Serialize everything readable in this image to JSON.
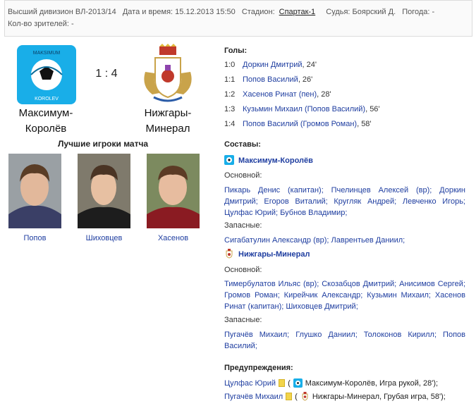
{
  "header": {
    "division": "Высший дивизион ВЛ-2013/14",
    "datetime": "Дата и время: 15.12.2013 15:50",
    "stadium_label": "Стадион:",
    "stadium": "Спартак-1",
    "referee": "Судья: Боярский Д.",
    "weather": "Погода: -",
    "spectators": "Кол-во зрителей: -"
  },
  "match": {
    "home_logo_text_top": "MAKSIMUM",
    "home_logo_text_bottom": "KOROLEV",
    "score": "1 : 4",
    "home_name": "Максимум-Королёв",
    "away_name": "Нижгары-Минерал"
  },
  "best_players": {
    "title": "Лучшие игроки матча",
    "players": [
      {
        "name": "Попов"
      },
      {
        "name": "Шиховцев"
      },
      {
        "name": "Хасенов"
      }
    ]
  },
  "goals": {
    "title": "Голы:",
    "items": [
      {
        "score": "1:0",
        "text": "Доркин Дмитрий",
        "minute": ", 24'"
      },
      {
        "score": "1:1",
        "text": "Попов Василий",
        "minute": ", 26'"
      },
      {
        "score": "1:2",
        "text": "Хасенов Ринат (пен)",
        "minute": ", 28'"
      },
      {
        "score": "1:3",
        "text": "Кузьмин Михаил (Попов Василий)",
        "minute": ", 56'"
      },
      {
        "score": "1:4",
        "text": "Попов Василий (Громов Роман)",
        "minute": ", 58'"
      }
    ]
  },
  "lineups": {
    "title": "Составы:",
    "main_label": "Основной:",
    "subs_label": "Запасные:",
    "home": {
      "name": "Максимум-Королёв",
      "main": "Пикарь Денис (капитан); Пчелинцев Алексей (вр); Доркин Дмитрий; Егоров Виталий; Кругляк Андрей; Левченко Игорь; Цулфас Юрий; Бубнов Владимир;",
      "subs": "Сигабатулин Александр (вр); Лаврентьев Даниил;"
    },
    "away": {
      "name": "Нижгары-Минерал",
      "main": "Тимербулатов Ильяс (вр); Скозабцов Дмитрий; Анисимов Сергей; Громов Роман; Кирейчик Александр; Кузьмин Михаил; Хасенов Ринат (капитан); Шиховцев Дмитрий;",
      "subs": "Пугачёв Михаил; Глушко Даниил; Толоконов Кирилл; Попов Василий;"
    }
  },
  "warnings": {
    "title": "Предупреждения:",
    "items": [
      {
        "player": "Цулфас Юрий",
        "detail": "Максимум-Королёв, Игра рукой, 28');"
      },
      {
        "player": "Пугачёв Михаил",
        "detail": "Нижгары-Минерал, Грубая игра, 58');"
      }
    ]
  },
  "colors": {
    "link": "#1f3ea0",
    "card_yellow": "#f2d44a",
    "home_logo_bg": "#19aee8"
  }
}
